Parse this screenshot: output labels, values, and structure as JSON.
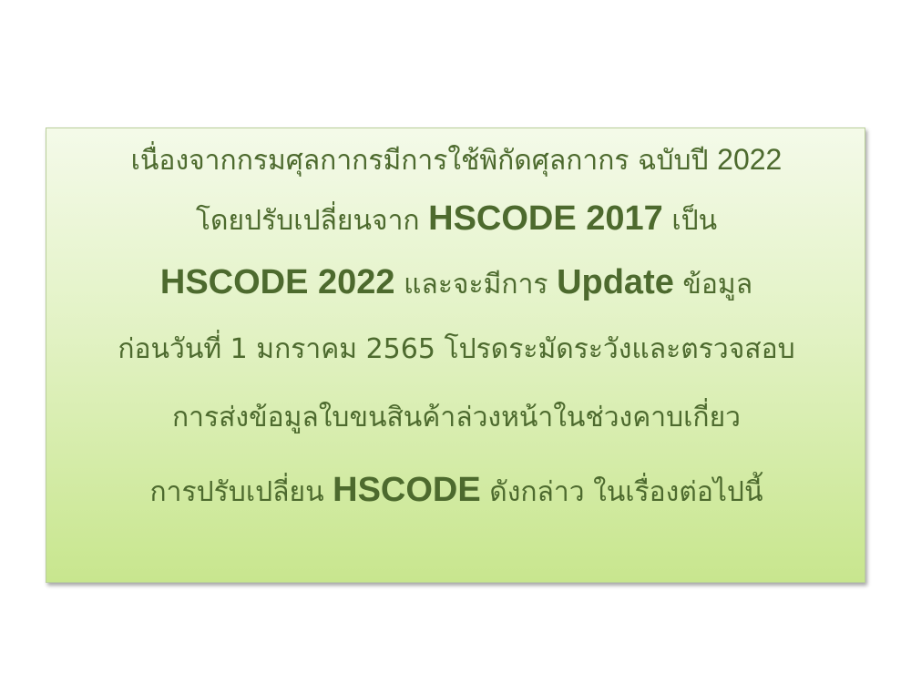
{
  "notice": {
    "line1": {
      "text_a": "เนื่องจากกรมศุลกากรมีการใช้พิกัดศุลกากร ฉบับปี ",
      "year": "2022"
    },
    "line2": {
      "text_a": "โดยปรับเปลี่ยนจาก  ",
      "code_a": "HSCODE 2017",
      "text_b": " เป็น"
    },
    "line3": {
      "code_b": "HSCODE 2022",
      "text_c": " และจะมีการ ",
      "update_word": "Update",
      "text_d": " ข้อมูล"
    },
    "line4": {
      "text_a": "ก่อนวันที่ 1 มกราคม 2565 โปรดระมัดระวังและตรวจสอบ"
    },
    "line5": {
      "text_a": "การส่งข้อมูลใบขนสินค้าล่วงหน้าในช่วงคาบเกี่ยว"
    },
    "line6": {
      "text_a": "การปรับเปลี่ยน ",
      "code_c": "HSCODE",
      "text_b": " ดังกล่าว ในเรื่องต่อไปนี้"
    }
  }
}
